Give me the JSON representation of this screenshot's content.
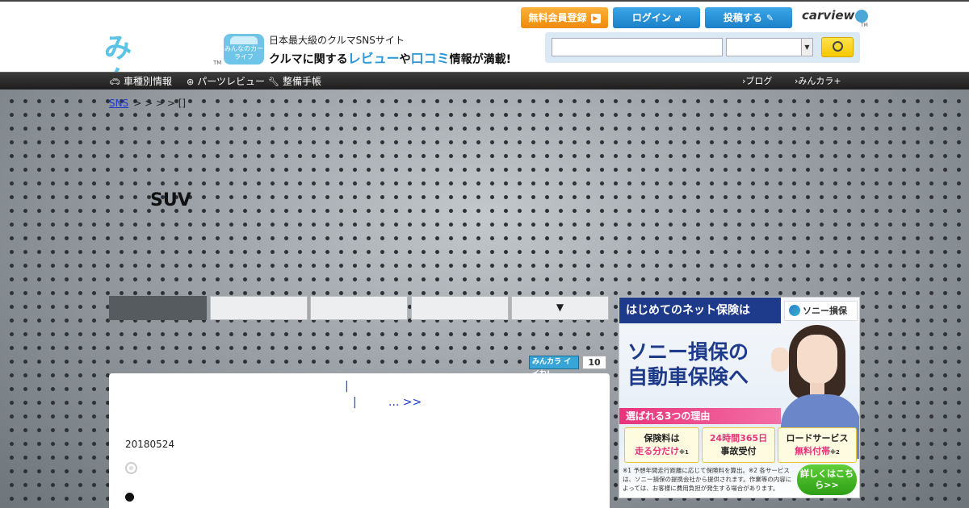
{
  "header": {
    "logo_text": "みんカラ",
    "logo_tm": "TM",
    "badge_text": "みんなのカーライフ",
    "tagline1": "日本最大級のクルマSNSサイト",
    "tagline2_a": "クルマに関する",
    "tagline2_review": "レビュー",
    "tagline2_b": "や",
    "tagline2_kuchikomi": "口コミ",
    "tagline2_c": "情報が満載!",
    "buttons": {
      "register": "無料会員登録",
      "login": "ログイン",
      "post": "投稿する"
    },
    "carview": "carview",
    "carview_tm": "TM"
  },
  "nav": {
    "car_info": "車種別情報",
    "parts_review": "パーツレビュー",
    "maintenance": "整備手帳",
    "blog": "ブログ",
    "minkara_plus": "みんカラ+"
  },
  "breadcrumb": {
    "root": "SNS",
    "seps": "> > > >",
    "last": "[]"
  },
  "page_title": "SUV",
  "tabs": {
    "more_arrow": "▼"
  },
  "iine": {
    "label": "みんカラ イイね!",
    "count": "10"
  },
  "content": {
    "link_a": "|",
    "link_b": "|",
    "more": "... >>",
    "date": "20180524"
  },
  "ad": {
    "banner": "はじめてのネット保険は",
    "brand": "ソニー損保",
    "headline1": "ソニー損保の",
    "headline2": "自動車保険へ",
    "reason": "選ばれる3つの理由",
    "cards": [
      {
        "line1": "保険料は",
        "line2": "走る分だけ",
        "mark": "※1"
      },
      {
        "line1": "24時間365日",
        "line2": "事故受付",
        "mark": ""
      },
      {
        "line1": "ロードサービス",
        "line2": "無料付帯",
        "mark": "※2"
      }
    ],
    "note": "※1 予想年間走行距離に応じて保険料を算出。※2 各サービスは、ソニー損保の提携会社から提供されます。作業等の内容によっては、お客様に費用負担が発生する場合があります。",
    "cta": "詳しくはこちら>>",
    "colors": {
      "navy": "#1e3a8a",
      "pink": "#e8337c",
      "green": "#2e9e15"
    }
  },
  "colors": {
    "accent_blue": "#2a97d8",
    "register_orange": "#f08a0c",
    "search_yellow": "#f5c800",
    "link_blue": "#1a3ad0"
  }
}
